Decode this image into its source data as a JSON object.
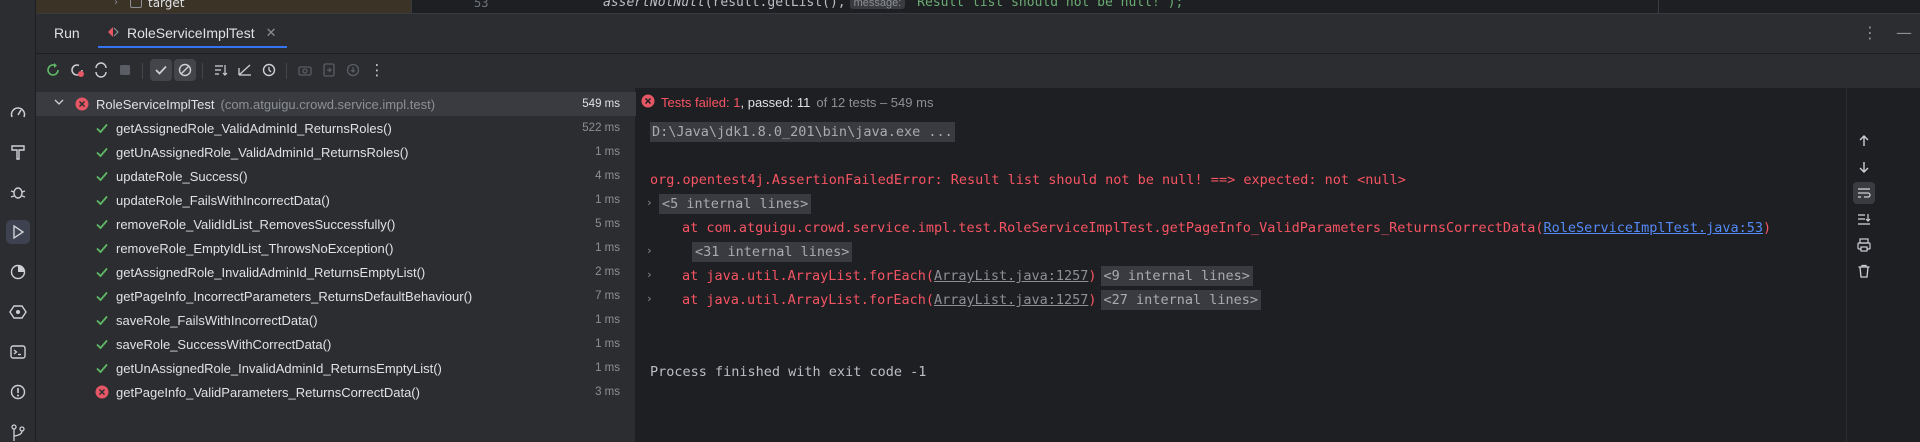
{
  "editor": {
    "tree_item": "target",
    "line_number": "53",
    "code_call": "assertNotNull",
    "code_args": "(result.getList(),",
    "param_hint": "message:",
    "code_string": "\"Result list should not be null!\");"
  },
  "toolwindow": {
    "title": "Run",
    "tab_label": "RoleServiceImplTest"
  },
  "tree": {
    "root": {
      "name": "RoleServiceImplTest",
      "package": "(com.atguigu.crowd.service.impl.test)",
      "duration": "549 ms",
      "status": "failed"
    },
    "tests": [
      {
        "name": "getAssignedRole_ValidAdminId_ReturnsRoles()",
        "duration": "522 ms",
        "status": "passed"
      },
      {
        "name": "getUnAssignedRole_ValidAdminId_ReturnsRoles()",
        "duration": "1 ms",
        "status": "passed"
      },
      {
        "name": "updateRole_Success()",
        "duration": "4 ms",
        "status": "passed"
      },
      {
        "name": "updateRole_FailsWithIncorrectData()",
        "duration": "1 ms",
        "status": "passed"
      },
      {
        "name": "removeRole_ValidIdList_RemovesSuccessfully()",
        "duration": "5 ms",
        "status": "passed"
      },
      {
        "name": "removeRole_EmptyIdList_ThrowsNoException()",
        "duration": "1 ms",
        "status": "passed"
      },
      {
        "name": "getAssignedRole_InvalidAdminId_ReturnsEmptyList()",
        "duration": "2 ms",
        "status": "passed"
      },
      {
        "name": "getPageInfo_IncorrectParameters_ReturnsDefaultBehaviour()",
        "duration": "7 ms",
        "status": "passed"
      },
      {
        "name": "saveRole_FailsWithIncorrectData()",
        "duration": "1 ms",
        "status": "passed"
      },
      {
        "name": "saveRole_SuccessWithCorrectData()",
        "duration": "1 ms",
        "status": "passed"
      },
      {
        "name": "getUnAssignedRole_InvalidAdminId_ReturnsEmptyList()",
        "duration": "1 ms",
        "status": "passed"
      },
      {
        "name": "getPageInfo_ValidParameters_ReturnsCorrectData()",
        "duration": "3 ms",
        "status": "failed"
      }
    ]
  },
  "console": {
    "status_failed": "Tests failed: 1",
    "status_passed": ", passed: 11",
    "status_count": "of 12 tests – 549 ms",
    "command": "D:\\Java\\jdk1.8.0_201\\bin\\java.exe ...",
    "error": "org.opentest4j.AssertionFailedError: Result list should not be null! ==> expected: not <null>",
    "fold1": "<5 internal lines>",
    "trace1_prefix": "at com.atguigu.crowd.service.impl.test.RoleServiceImplTest.getPageInfo_ValidParameters_ReturnsCorrectData(",
    "trace1_link": "RoleServiceImplTest.java:53",
    "trace1_suffix": ")",
    "fold2": "<31 internal lines>",
    "trace2_prefix": "at java.util.ArrayList.forEach(",
    "trace2_link": "ArrayList.java:1257",
    "trace2_suffix": ")",
    "fold3": "<9 internal lines>",
    "trace3_prefix": "at java.util.ArrayList.forEach(",
    "trace3_link": "ArrayList.java:1257",
    "trace3_suffix": ")",
    "fold4": "<27 internal lines>",
    "exit": "Process finished with exit code -1"
  },
  "colors": {
    "pass": "#5fb865",
    "fail": "#e55765",
    "accent": "#3574f0"
  }
}
